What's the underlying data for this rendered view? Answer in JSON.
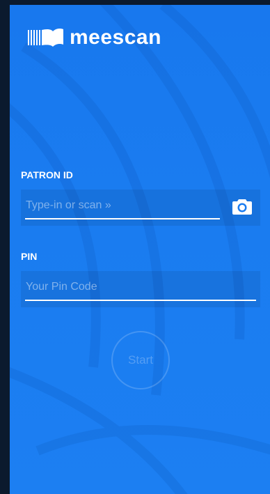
{
  "app": {
    "brand": "meescan"
  },
  "patron": {
    "label": "PATRON ID",
    "placeholder": "Type-in or scan »",
    "scan_icon": "camera-icon"
  },
  "pin": {
    "label": "PIN",
    "placeholder": "Your Pin Code"
  },
  "actions": {
    "start_label": "Start"
  },
  "colors": {
    "background": "#1a7cf0",
    "text": "#ffffff",
    "outer_frame": "#0b1a2e"
  }
}
